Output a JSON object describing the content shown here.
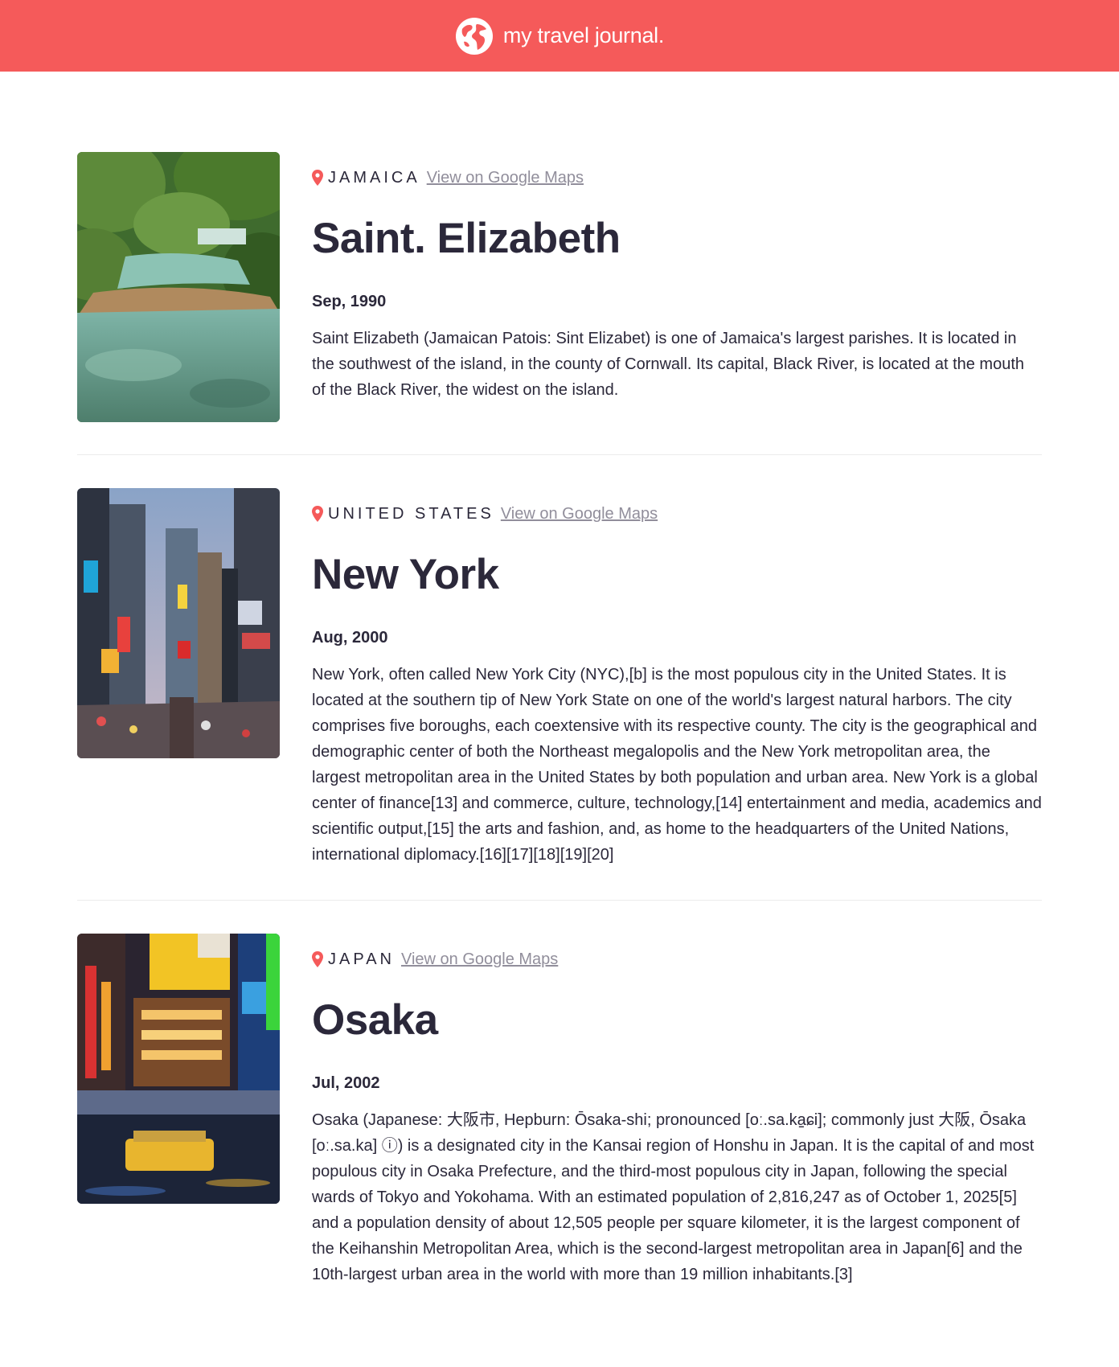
{
  "header": {
    "title": "my travel journal.",
    "icon": "globe-icon",
    "background": "#f55a5a"
  },
  "entries": [
    {
      "country": "JAMAICA",
      "link_label": "View on Google Maps",
      "place": "Saint. Elizabeth",
      "date": "Sep, 1990",
      "description": "Saint Elizabeth (Jamaican Patois: Sint Elizabet) is one of Jamaica's largest parishes. It is located in the southwest of the island, in the county of Cornwall. Its capital, Black River, is located at the mouth of the Black River, the widest on the island."
    },
    {
      "country": "UNITED STATES",
      "link_label": "View on Google Maps",
      "place": "New York",
      "date": "Aug, 2000",
      "description": "New York, often called New York City (NYC),[b] is the most populous city in the United States. It is located at the southern tip of New York State on one of the world's largest natural harbors. The city comprises five boroughs, each coextensive with its respective county. The city is the geographical and demographic center of both the Northeast megalopolis and the New York metropolitan area, the largest metropolitan area in the United States by both population and urban area. New York is a global center of finance[13] and commerce, culture, technology,[14] entertainment and media, academics and scientific output,[15] the arts and fashion, and, as home to the headquarters of the United Nations, international diplomacy.[16][17][18][19][20]"
    },
    {
      "country": "JAPAN",
      "link_label": "View on Google Maps",
      "place": "Osaka",
      "date": "Jul, 2002",
      "description": "Osaka (Japanese: 大阪市, Hepburn: Ōsaka-shi; pronounced [oː.sa.ka̠ɕi]; commonly just 大阪, Ōsaka [oː.sa.ka] ⓘ) is a designated city in the Kansai region of Honshu in Japan. It is the capital of and most populous city in Osaka Prefecture, and the third-most populous city in Japan, following the special wards of Tokyo and Yokohama. With an estimated population of 2,816,247 as of October 1, 2025[5] and a population density of about 12,505 people per square kilometer, it is the largest component of the Keihanshin Metropolitan Area, which is the second-largest metropolitan area in Japan[6] and the 10th-largest urban area in the world with more than 19 million inhabitants.[3]"
    }
  ],
  "colors": {
    "accent": "#f55a5a",
    "text": "#2b283a",
    "link": "#918e9b"
  }
}
